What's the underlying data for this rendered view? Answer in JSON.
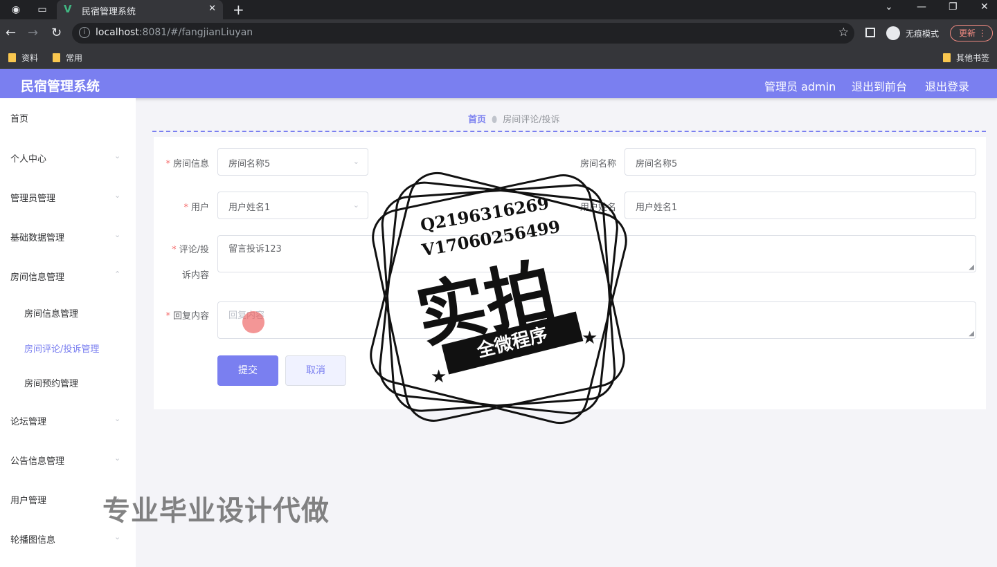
{
  "browser": {
    "tab_title": "民宿管理系统",
    "url_host": "localhost",
    "url_rest": ":8081/#/fangjianLiuyan",
    "incognito_label": "无痕模式",
    "update_label": "更新",
    "bookmarks": [
      "资料",
      "常用"
    ],
    "other_bookmarks": "其他书签"
  },
  "header": {
    "brand": "民宿管理系统",
    "admin": "管理员 admin",
    "to_front": "退出到前台",
    "logout": "退出登录"
  },
  "sidebar": {
    "items": [
      {
        "label": "首页"
      },
      {
        "label": "个人中心"
      },
      {
        "label": "管理员管理"
      },
      {
        "label": "基础数据管理"
      },
      {
        "label": "房间信息管理"
      },
      {
        "label": "论坛管理"
      },
      {
        "label": "公告信息管理"
      },
      {
        "label": "用户管理"
      },
      {
        "label": "轮播图信息"
      }
    ],
    "sub_items": [
      {
        "label": "房间信息管理"
      },
      {
        "label": "房间评论/投诉管理"
      },
      {
        "label": "房间预约管理"
      }
    ]
  },
  "breadcrumb": {
    "home": "首页",
    "current": "房间评论/投诉"
  },
  "form": {
    "room_info_label": "房间信息",
    "room_info_value": "房间名称5",
    "room_name_label": "房间名称",
    "room_name_value": "房间名称5",
    "user_label": "用户",
    "user_value": "用户姓名1",
    "user_name_label": "用户姓名",
    "user_name_value": "用户姓名1",
    "comment_label_1": "评论/投",
    "comment_label_2": "诉内容",
    "comment_value": "留言投诉123",
    "reply_label": "回复内容",
    "reply_placeholder": "回复内容",
    "submit": "提交",
    "cancel": "取消"
  },
  "watermark": {
    "qq": "Q2196316269",
    "wechat": "V17060256499",
    "big": "实拍",
    "ribbon": "全微程序",
    "bottom": "专业毕业设计代做"
  }
}
